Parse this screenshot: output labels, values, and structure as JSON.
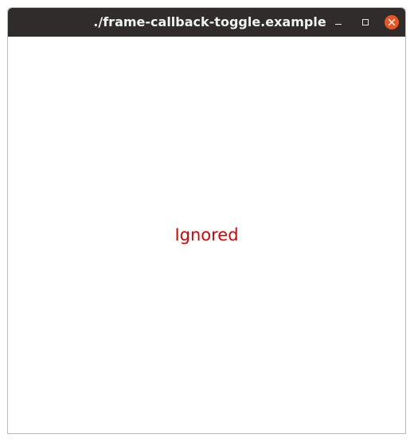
{
  "window": {
    "title": "./frame-callback-toggle.example"
  },
  "controls": {
    "minimize_icon": "minimize-icon",
    "maximize_icon": "maximize-icon",
    "close_icon": "close-icon",
    "close_color": "#e95420"
  },
  "content": {
    "message": "Ignored",
    "message_color": "#e00000"
  }
}
